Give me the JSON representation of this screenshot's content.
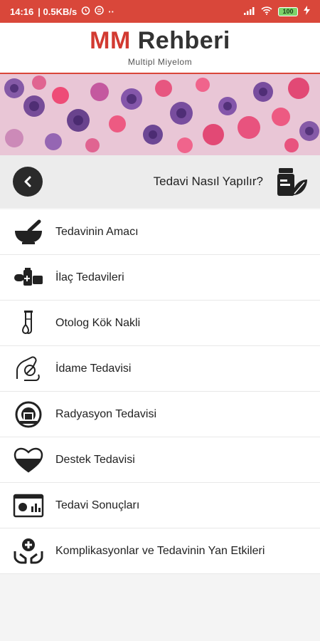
{
  "status": {
    "time": "14:16",
    "speed": "| 0.5KB/s",
    "extras": "··",
    "battery": "100"
  },
  "header": {
    "logo_mm": "MM",
    "logo_rehberi": "Rehberi",
    "subtitle": "Multipl Miyelom"
  },
  "titlebar": {
    "title": "Tedavi Nasıl Yapılır?"
  },
  "menu": {
    "items": [
      {
        "label": "Tedavinin Amacı",
        "icon": "mortar-pestle-icon"
      },
      {
        "label": "İlaç Tedavileri",
        "icon": "medicine-icon"
      },
      {
        "label": "Otolog Kök Nakli",
        "icon": "test-tube-icon"
      },
      {
        "label": "İdame Tedavisi",
        "icon": "hand-pill-icon"
      },
      {
        "label": "Radyasyon Tedavisi",
        "icon": "radiation-machine-icon"
      },
      {
        "label": "Destek Tedavisi",
        "icon": "heart-icon"
      },
      {
        "label": "Tedavi Sonuçları",
        "icon": "results-chart-icon"
      },
      {
        "label": "Komplikasyonlar ve Tedavinin Yan Etkileri",
        "icon": "hands-medical-cross-icon"
      }
    ]
  },
  "colors": {
    "brand_red": "#d23a31",
    "status_bar": "#d9473a"
  }
}
